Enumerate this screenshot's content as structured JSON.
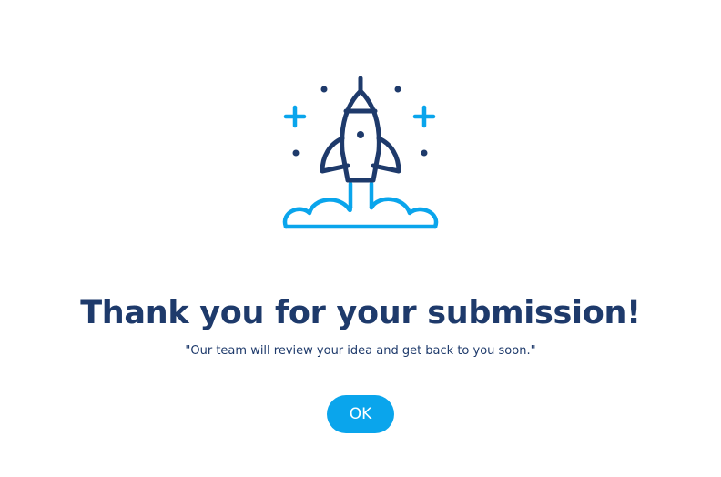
{
  "dialog": {
    "illustration_icon": "rocket-launch-icon",
    "title": "Thank you for your submission!",
    "message": "\"Our team will review your idea and get back to you soon.\"",
    "ok_label": "OK"
  },
  "colors": {
    "navy": "#1e3a6b",
    "accent_blue": "#0aa5ec",
    "background": "#ffffff"
  }
}
